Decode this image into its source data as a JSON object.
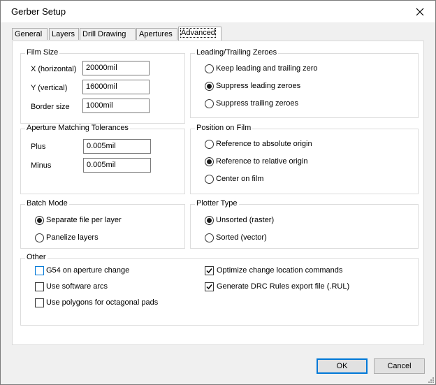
{
  "window": {
    "title": "Gerber Setup"
  },
  "tabs": [
    "General",
    "Layers",
    "Drill Drawing",
    "Apertures",
    "Advanced"
  ],
  "film_size": {
    "title": "Film Size",
    "x_label": "X (horizontal)",
    "x_value": "20000mil",
    "y_label": "Y (vertical)",
    "y_value": "16000mil",
    "border_label": "Border size",
    "border_value": "1000mil"
  },
  "zeroes": {
    "title": "Leading/Trailing Zeroes",
    "options": [
      "Keep leading and trailing zero",
      "Suppress leading zeroes",
      "Suppress trailing zeroes"
    ],
    "selected": 1
  },
  "aperture_tol": {
    "title": "Aperture Matching Tolerances",
    "plus_label": "Plus",
    "plus_value": "0.005mil",
    "minus_label": "Minus",
    "minus_value": "0.005mil"
  },
  "position": {
    "title": "Position on Film",
    "options": [
      "Reference to absolute origin",
      "Reference to relative origin",
      "Center on film"
    ],
    "selected": 1
  },
  "batch": {
    "title": "Batch Mode",
    "options": [
      "Separate file per layer",
      "Panelize layers"
    ],
    "selected": 0
  },
  "plotter": {
    "title": "Plotter Type",
    "options": [
      "Unsorted (raster)",
      "Sorted (vector)"
    ],
    "selected": 0
  },
  "other": {
    "title": "Other",
    "items": [
      {
        "label": "G54 on aperture change",
        "checked": false
      },
      {
        "label": "Use software arcs",
        "checked": false
      },
      {
        "label": "Use polygons for octagonal pads",
        "checked": false
      },
      {
        "label": "Optimize change location commands",
        "checked": true
      },
      {
        "label": "Generate DRC Rules export file (.RUL)",
        "checked": true
      }
    ]
  },
  "buttons": {
    "ok": "OK",
    "cancel": "Cancel"
  }
}
